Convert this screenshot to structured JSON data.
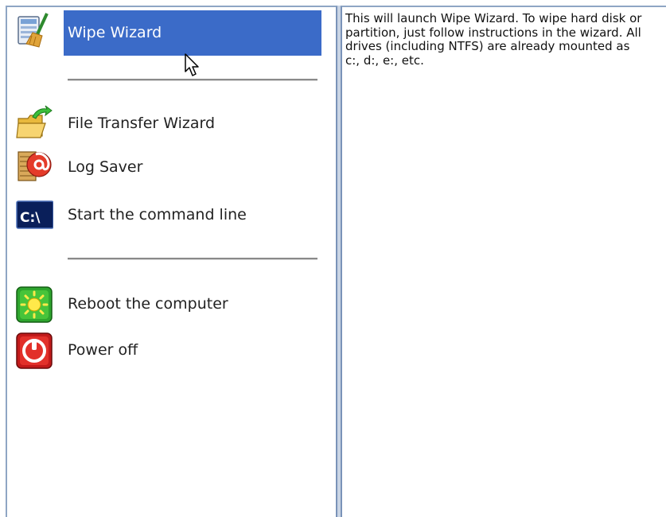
{
  "menu": {
    "items": [
      {
        "id": "wipe",
        "label": "Wipe Wizard",
        "icon": "wipe-wizard-icon",
        "selected": true
      },
      {
        "id": "transfer",
        "label": "File Transfer Wizard",
        "icon": "folder-transfer-icon",
        "selected": false
      },
      {
        "id": "log",
        "label": "Log Saver",
        "icon": "log-saver-icon",
        "selected": false
      },
      {
        "id": "cmd",
        "label": "Start the command line",
        "icon": "command-line-icon",
        "selected": false
      },
      {
        "id": "reboot",
        "label": "Reboot the computer",
        "icon": "reboot-icon",
        "selected": false
      },
      {
        "id": "power",
        "label": "Power off",
        "icon": "power-off-icon",
        "selected": false
      }
    ],
    "command_icon_text": "C:\\"
  },
  "description": {
    "text": "This will launch Wipe Wizard. To wipe hard disk or partition, just follow instructions in the wizard. All drives (including NTFS) are already mounted as c:, d:, e:, etc."
  },
  "colors": {
    "selection": "#3b6bc8",
    "pane_border": "#7a93b8"
  }
}
